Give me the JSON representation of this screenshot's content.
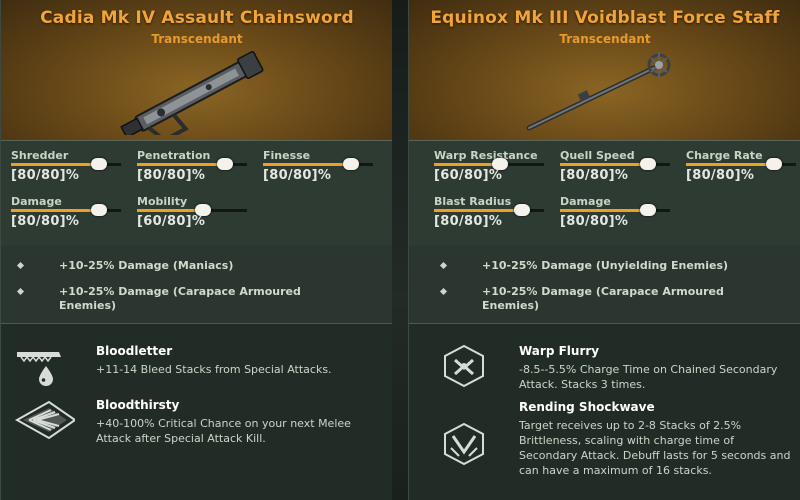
{
  "cards": [
    {
      "title": "Cadia Mk IV Assault Chainsword",
      "rarity": "Transcendant",
      "weapon_image": "chainsword",
      "stats": [
        {
          "label": "Shredder",
          "value": "[80/80]%",
          "fill": 0.8
        },
        {
          "label": "Penetration",
          "value": "[80/80]%",
          "fill": 0.8
        },
        {
          "label": "Finesse",
          "value": "[80/80]%",
          "fill": 0.8
        },
        {
          "label": "Damage",
          "value": "[80/80]%",
          "fill": 0.8
        },
        {
          "label": "Mobility",
          "value": "[60/80]%",
          "fill": 0.6
        }
      ],
      "perks": [
        "+10-25% Damage (Maniacs)",
        "+10-25% Damage (Carapace Armoured Enemies)"
      ],
      "blessings": [
        {
          "icon": "bloodletter-icon",
          "name": "Bloodletter",
          "description": "+11-14 Bleed Stacks from Special Attacks."
        },
        {
          "icon": "bloodthirsty-icon",
          "name": "Bloodthirsty",
          "description": "+40-100% Critical Chance on your next Melee Attack after Special Attack Kill."
        }
      ]
    },
    {
      "title": "Equinox Mk III Voidblast Force Staff",
      "rarity": "Transcendant",
      "weapon_image": "force-staff",
      "stats": [
        {
          "label": "Warp Resistance",
          "value": "[60/80]%",
          "fill": 0.6
        },
        {
          "label": "Quell Speed",
          "value": "[80/80]%",
          "fill": 0.8
        },
        {
          "label": "Charge Rate",
          "value": "[80/80]%",
          "fill": 0.8
        },
        {
          "label": "Blast Radius",
          "value": "[80/80]%",
          "fill": 0.8
        },
        {
          "label": "Damage",
          "value": "[80/80]%",
          "fill": 0.8
        }
      ],
      "perks": [
        "+10-25% Damage (Unyielding Enemies)",
        "+10-25% Damage (Carapace Armoured Enemies)"
      ],
      "blessings": [
        {
          "icon": "warp-flurry-icon",
          "name": "Warp Flurry",
          "description": "-8.5--5.5% Charge Time on Chained Secondary Attack. Stacks 3 times."
        },
        {
          "icon": "rending-shockwave-icon",
          "name": "Rending Shockwave",
          "description": "Target receives up to 2-8 Stacks of 2.5% Brittleness, scaling with charge time of Secondary Attack. Debuff lasts for 5 seconds and can have a maximum of 16 stacks."
        }
      ]
    }
  ],
  "colors": {
    "title": "#f0a43a",
    "bar_fill": "#f0a020",
    "panel": "#2a362f"
  }
}
